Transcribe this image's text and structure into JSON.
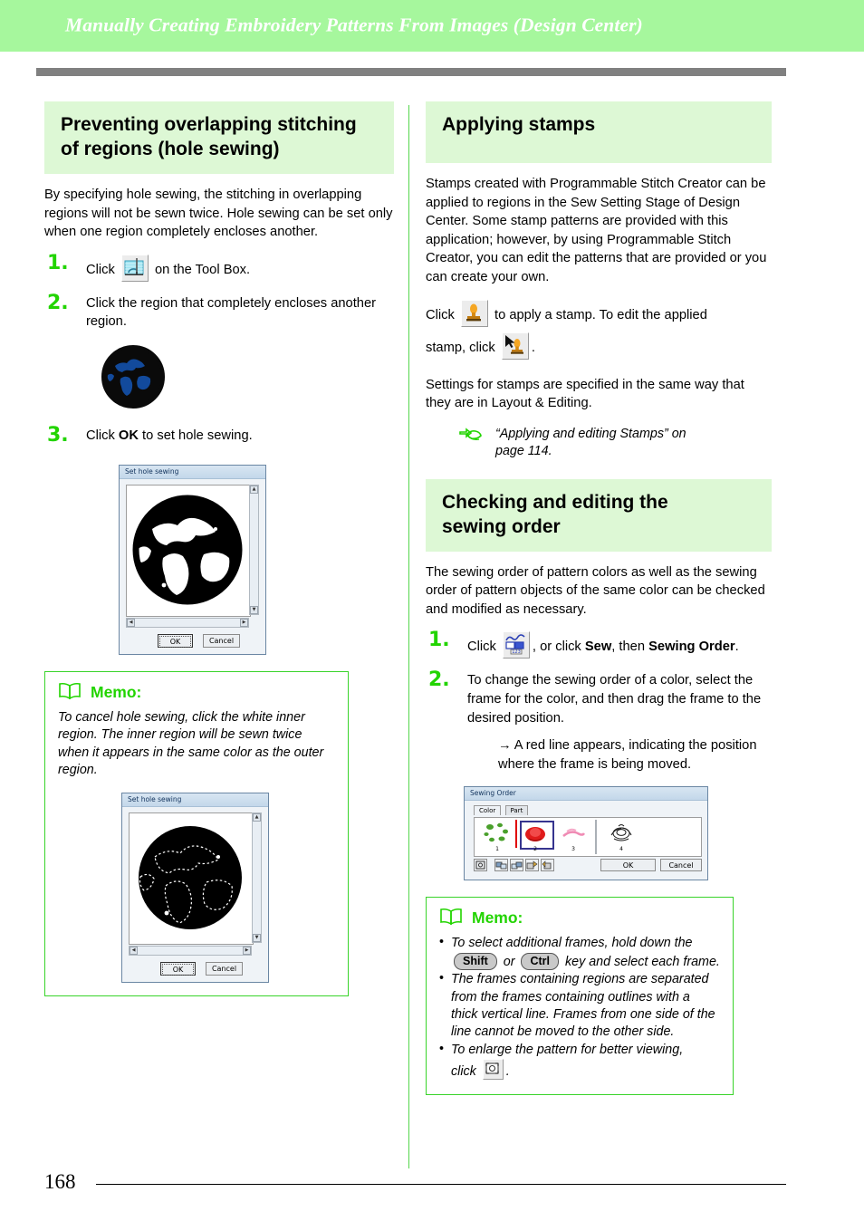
{
  "header": {
    "title": "Manually Creating Embroidery Patterns From Images (Design Center)"
  },
  "colors": {
    "header_band": "#a6f79d",
    "section_heading_bg": "#ddf8d5",
    "accent_green": "#22d400",
    "divider_green": "#55d64c",
    "rule_gray": "#808080"
  },
  "left_column": {
    "section_heading_line1": "Preventing overlapping stitching",
    "section_heading_line2": "of regions (hole sewing)",
    "intro": "By specifying hole sewing, the stitching in overlapping regions will not be sewn twice. Hole sewing can be set only when one region completely encloses another.",
    "steps": [
      {
        "num": "1.",
        "text_before": "Click",
        "icon": "hole-sewing-tool-icon",
        "text_after": "on the Tool Box."
      },
      {
        "num": "2.",
        "text": "Click the region that completely encloses another region."
      },
      {
        "num": "3.",
        "text_before": "Click",
        "bold": "OK",
        "text_after": "to set hole sewing."
      }
    ],
    "dialog": {
      "title": "Set hole sewing",
      "ok_label": "OK",
      "cancel_label": "Cancel"
    },
    "memo": {
      "label": "Memo:",
      "text": "To cancel hole sewing, click the white inner region. The inner region will be sewn twice when it appears in the same color as the outer region.",
      "dialog": {
        "title": "Set hole sewing",
        "ok_label": "OK",
        "cancel_label": "Cancel"
      }
    }
  },
  "right_column": {
    "section1_heading": "Applying stamps",
    "section1_intro": "Stamps created with Programmable Stitch Creator can be applied to regions in the Sew Setting Stage of Design Center. Some stamp patterns are provided with this application; however, by using Programmable Stitch Creator, you can edit the patterns that are provided or you can create your own.",
    "stamp_click_before": "Click",
    "stamp_click_middle": "to apply a stamp. To edit the applied",
    "stamp_click_line2": "stamp, click",
    "stamp_click_end": ".",
    "stamp_apply_icon": "stamp-icon",
    "stamp_edit_icon": "edit-stamp-icon",
    "settings_note": "Settings for stamps are specified in the same way that they are in Layout & Editing.",
    "reference": {
      "icon": "pointing-hand-icon",
      "line1": "“Applying and editing Stamps” on",
      "line2": "page 114."
    },
    "section2_heading_line1": "Checking and editing the",
    "section2_heading_line2": "sewing order",
    "section2_intro": "The sewing order of pattern colors as well as the sewing order of pattern objects of the same color can be checked and modified as necessary.",
    "steps": [
      {
        "num": "1.",
        "text_before": "Click",
        "icon": "sewing-order-icon",
        "text_mid": ", or click",
        "bold1": "Sew",
        "text_mid2": ", then",
        "bold2": "Sewing Order",
        "text_after": "."
      },
      {
        "num": "2.",
        "text": "To change the sewing order of a color, select the frame for the color, and then drag the frame to the desired position.",
        "substep": "A red line appears, indicating the position where the frame is being moved."
      }
    ],
    "dialog": {
      "title": "Sewing Order",
      "tabs": [
        "Color",
        "Part"
      ],
      "frames": [
        "1",
        "2",
        "3",
        "4"
      ],
      "ok_label": "OK",
      "cancel_label": "Cancel",
      "toolbar_icons": [
        "zoom-frame-icon",
        "move-first-icon",
        "move-prev-icon",
        "move-next-icon",
        "move-last-icon"
      ]
    },
    "memo": {
      "label": "Memo:",
      "bullets": [
        {
          "part1": "To select additional frames, hold down the",
          "key1": "Shift",
          "or": "or",
          "key2": "Ctrl",
          "part2": "key and select each",
          "part3": "frame."
        },
        {
          "text": "The frames containing regions are separated from the frames containing outlines with a thick vertical line. Frames from one side of the line cannot be moved to the other side."
        },
        {
          "text": "To enlarge the pattern for better viewing,",
          "text2": "click",
          "icon": "zoom-frame-icon",
          "text3": "."
        }
      ]
    }
  },
  "footer": {
    "page_number": "168"
  }
}
